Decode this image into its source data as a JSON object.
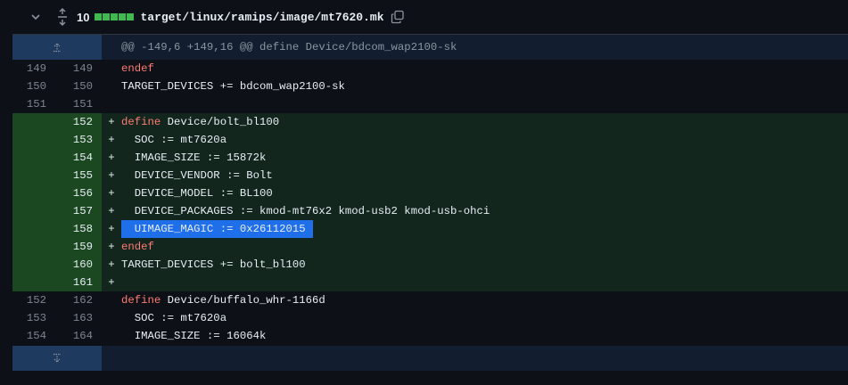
{
  "file": {
    "changes_count": "10",
    "path": "target/linux/ramips/image/mt7620.mk"
  },
  "hunk_header": "@@ -149,6 +149,16 @@ define Device/bdcom_wap2100-sk",
  "colors": {
    "added_bg": "#12261e",
    "added_gutter": "#1b4721",
    "keyword": "#ff7b72",
    "selection": "#1f6feb"
  },
  "lines": [
    {
      "old": "149",
      "new": "149",
      "sign": "",
      "kw": "endef",
      "text": "",
      "type": "context"
    },
    {
      "old": "150",
      "new": "150",
      "sign": "",
      "kw": "",
      "text": "TARGET_DEVICES += bdcom_wap2100-sk",
      "type": "context"
    },
    {
      "old": "151",
      "new": "151",
      "sign": "",
      "kw": "",
      "text": "",
      "type": "context"
    },
    {
      "old": "",
      "new": "152",
      "sign": "+",
      "kw": "define",
      "text": " Device/bolt_bl100",
      "type": "add"
    },
    {
      "old": "",
      "new": "153",
      "sign": "+",
      "kw": "",
      "text": "  SOC := mt7620a",
      "type": "add"
    },
    {
      "old": "",
      "new": "154",
      "sign": "+",
      "kw": "",
      "text": "  IMAGE_SIZE := 15872k",
      "type": "add"
    },
    {
      "old": "",
      "new": "155",
      "sign": "+",
      "kw": "",
      "text": "  DEVICE_VENDOR := Bolt",
      "type": "add"
    },
    {
      "old": "",
      "new": "156",
      "sign": "+",
      "kw": "",
      "text": "  DEVICE_MODEL := BL100",
      "type": "add"
    },
    {
      "old": "",
      "new": "157",
      "sign": "+",
      "kw": "",
      "text": "  DEVICE_PACKAGES := kmod-mt76x2 kmod-usb2 kmod-usb-ohci",
      "type": "add"
    },
    {
      "old": "",
      "new": "158",
      "sign": "+",
      "kw": "",
      "text": "  UIMAGE_MAGIC := 0x26112015",
      "type": "add-selected"
    },
    {
      "old": "",
      "new": "159",
      "sign": "+",
      "kw": "endef",
      "text": "",
      "type": "add"
    },
    {
      "old": "",
      "new": "160",
      "sign": "+",
      "kw": "",
      "text": "TARGET_DEVICES += bolt_bl100",
      "type": "add"
    },
    {
      "old": "",
      "new": "161",
      "sign": "+",
      "kw": "",
      "text": "",
      "type": "add"
    },
    {
      "old": "152",
      "new": "162",
      "sign": "",
      "kw": "define",
      "text": " Device/buffalo_whr-1166d",
      "type": "context"
    },
    {
      "old": "153",
      "new": "163",
      "sign": "",
      "kw": "",
      "text": "  SOC := mt7620a",
      "type": "context"
    },
    {
      "old": "154",
      "new": "164",
      "sign": "",
      "kw": "",
      "text": "  IMAGE_SIZE := 16064k",
      "type": "context"
    }
  ]
}
